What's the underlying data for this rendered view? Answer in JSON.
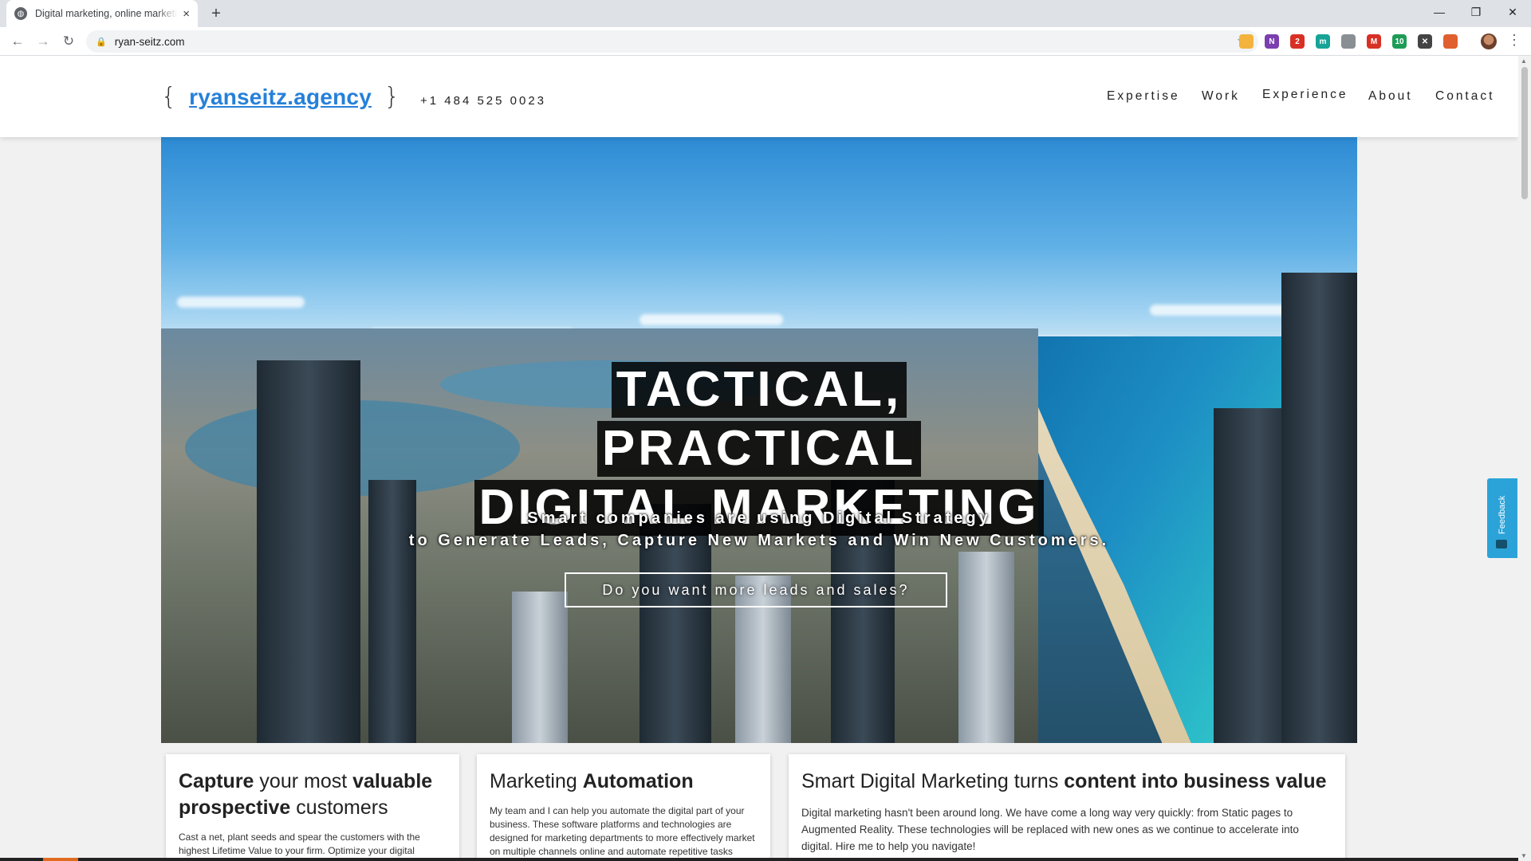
{
  "browser": {
    "tab_title": "Digital marketing, online marketing",
    "new_tab": "+",
    "tab_close": "×",
    "url": "ryan-seitz.com",
    "window_controls": {
      "minimize": "—",
      "restore": "❐",
      "close": "✕"
    },
    "nav": {
      "back": "←",
      "forward": "→",
      "reload": "↻"
    },
    "star": "☆",
    "kebab": "⋮",
    "lock": "🔒",
    "extensions": [
      {
        "name": "extension-1-icon",
        "label": "",
        "color": "#f3b33d"
      },
      {
        "name": "onenote-icon",
        "label": "N",
        "color": "#7b3fb0"
      },
      {
        "name": "extension-3-icon",
        "label": "2",
        "color": "#d93025"
      },
      {
        "name": "extension-4-icon",
        "label": "m",
        "color": "#17a398"
      },
      {
        "name": "extension-5-icon",
        "label": "",
        "color": "#8a8f94"
      },
      {
        "name": "gmail-icon",
        "label": "M",
        "color": "#d93025"
      },
      {
        "name": "extension-7-icon",
        "label": "10",
        "color": "#1e9c56"
      },
      {
        "name": "extension-8-icon",
        "label": "✕",
        "color": "#444444"
      },
      {
        "name": "extension-9-icon",
        "label": "",
        "color": "#e06030"
      }
    ]
  },
  "site": {
    "logo_open": "{",
    "logo_text": "ryanseitz.agency",
    "logo_close": "}",
    "phone": "+1 484 525 0023",
    "nav": [
      "Expertise",
      "Work",
      "Experience",
      "About",
      "Contact"
    ]
  },
  "hero": {
    "headline": [
      "TACTICAL,",
      "PRACTICAL",
      "DIGITAL MARKETING"
    ],
    "sub_line1": "Smart companies are using Digital Strategy",
    "sub_line2": "to Generate Leads, Capture New Markets and Win New Customers.",
    "cta": "Do you want more leads and sales?"
  },
  "cards": [
    {
      "title_parts": [
        "Capture",
        " your most ",
        "valuable prospective",
        " customers"
      ],
      "body": "Cast a net, plant seeds and spear the customers with the highest Lifetime Value to your firm. Optimize your digital footprint and maximize your"
    },
    {
      "title_parts": [
        "Marketing ",
        "Automation"
      ],
      "body": "My team and I can help you automate the digital part of your business. These software platforms and technologies are designed for marketing departments to more effectively market on multiple channels online and automate repetitive tasks"
    },
    {
      "title_parts": [
        "Smart Digital Marketing turns ",
        "content into business value"
      ],
      "body": "Digital marketing hasn't been around long. We have come a long way very quickly: from Static pages to Augmented Reality. These technologies will be replaced with new ones as we continue to accelerate into digital. Hire me to help you navigate!"
    }
  ],
  "feedback": {
    "label": "Feedback",
    "color": "#2ba3d9"
  }
}
